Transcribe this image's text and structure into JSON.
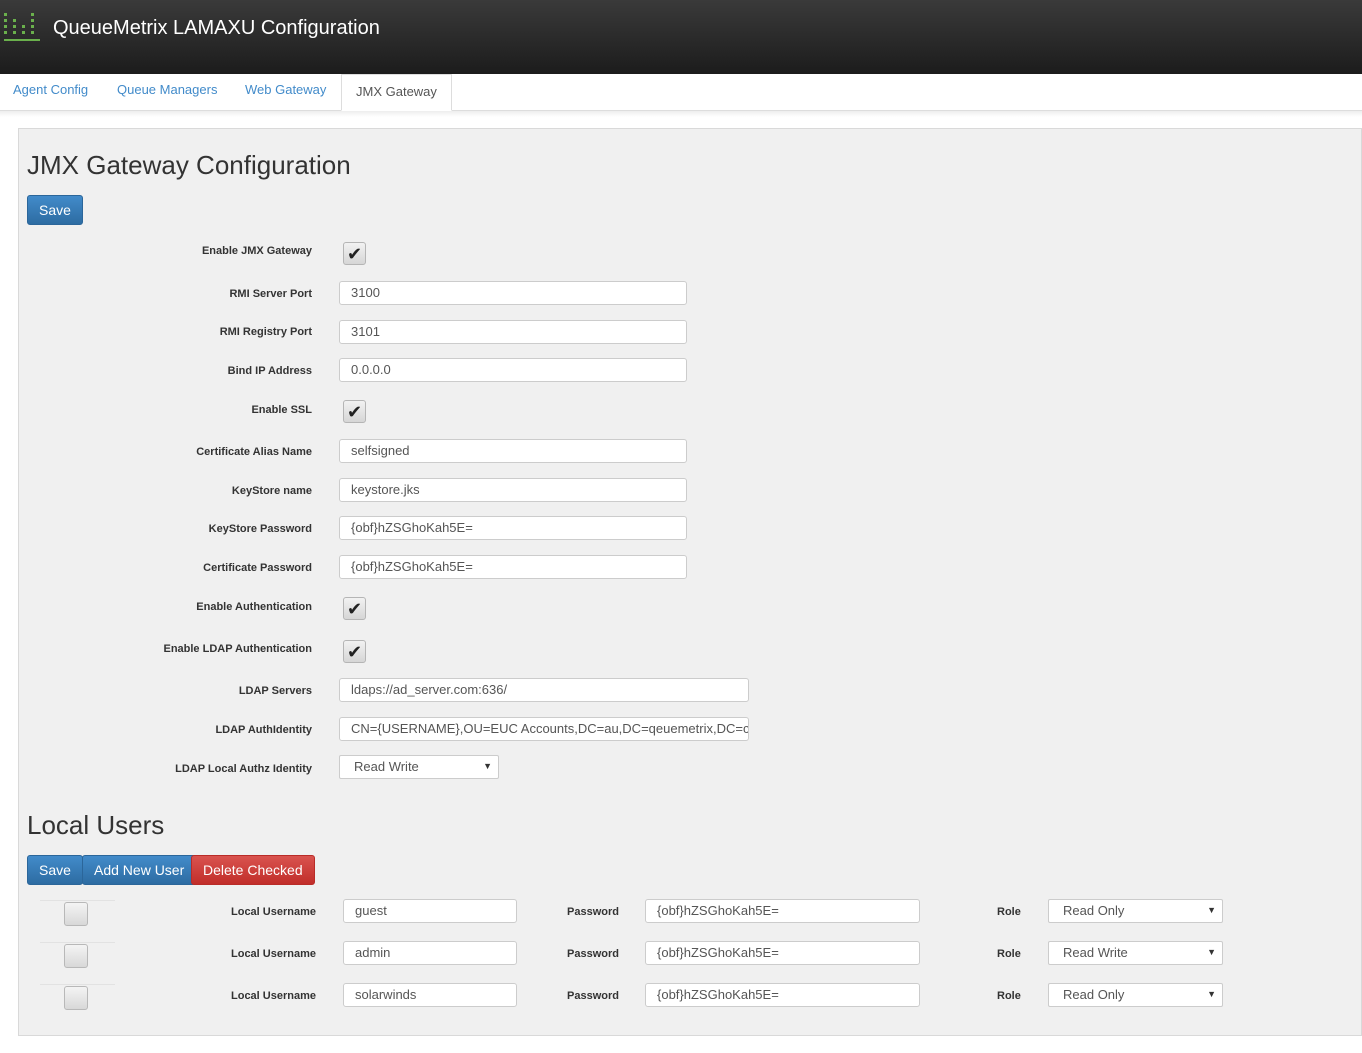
{
  "header": {
    "title": "QueueMetrix LAMAXU Configuration",
    "logo_icon": "bar-chart-icon",
    "accent": "#6ab04c"
  },
  "tabs": [
    {
      "label": "Agent Config"
    },
    {
      "label": "Queue Managers"
    },
    {
      "label": "Web Gateway"
    },
    {
      "label": "JMX Gateway",
      "active": true
    }
  ],
  "jmx": {
    "title": "JMX Gateway Configuration",
    "save_label": "Save",
    "fields": {
      "enable_jmx": {
        "label": "Enable JMX Gateway",
        "checked": true
      },
      "rmi_server_port": {
        "label": "RMI Server Port",
        "value": "3100"
      },
      "rmi_registry_port": {
        "label": "RMI Registry Port",
        "value": "3101"
      },
      "bind_ip": {
        "label": "Bind IP Address",
        "value": "0.0.0.0"
      },
      "enable_ssl": {
        "label": "Enable SSL",
        "checked": true
      },
      "cert_alias": {
        "label": "Certificate Alias Name",
        "value": "selfsigned"
      },
      "keystore_name": {
        "label": "KeyStore name",
        "value": "keystore.jks"
      },
      "keystore_password": {
        "label": "KeyStore Password",
        "value": "{obf}hZSGhoKah5E="
      },
      "cert_password": {
        "label": "Certificate Password",
        "value": "{obf}hZSGhoKah5E="
      },
      "enable_auth": {
        "label": "Enable Authentication",
        "checked": true
      },
      "enable_ldap": {
        "label": "Enable LDAP Authentication",
        "checked": true
      },
      "ldap_servers": {
        "label": "LDAP Servers",
        "value": "ldaps://ad_server.com:636/"
      },
      "ldap_authidentity": {
        "label": "LDAP AuthIdentity",
        "value": "CN={USERNAME},OU=EUC Accounts,DC=au,DC=qeuemetrix,DC=cc"
      },
      "ldap_local_authz": {
        "label": "LDAP Local Authz Identity",
        "value": "Read Write"
      }
    }
  },
  "local_users": {
    "title": "Local Users",
    "save_label": "Save",
    "add_label": "Add New User",
    "delete_label": "Delete Checked",
    "username_label": "Local Username",
    "password_label": "Password",
    "role_label": "Role",
    "rows": [
      {
        "username": "guest",
        "password": "{obf}hZSGhoKah5E=",
        "role": "Read Only"
      },
      {
        "username": "admin",
        "password": "{obf}hZSGhoKah5E=",
        "role": "Read Write"
      },
      {
        "username": "solarwinds",
        "password": "{obf}hZSGhoKah5E=",
        "role": "Read Only"
      }
    ]
  }
}
